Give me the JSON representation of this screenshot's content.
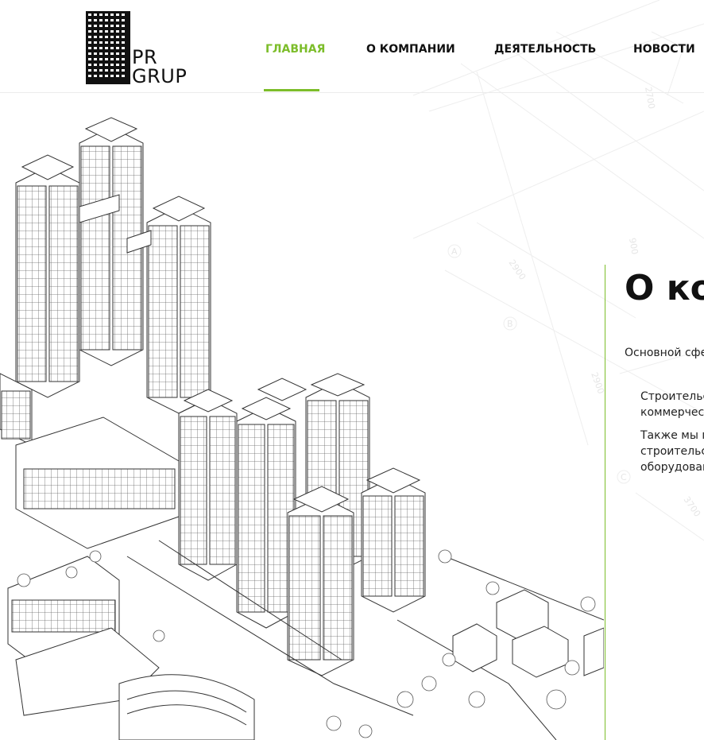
{
  "brand": {
    "line1": "PR",
    "line2": "GRUP"
  },
  "nav": {
    "items": [
      {
        "label": "ГЛАВНАЯ",
        "active": true
      },
      {
        "label": "О КОМПАНИИ",
        "active": false
      },
      {
        "label": "ДЕЯТЕЛЬНОСТЬ",
        "active": false
      },
      {
        "label": "НОВОСТИ",
        "active": false
      }
    ]
  },
  "about": {
    "title": "О ко",
    "lead": "Основной сфе",
    "paragraphs": [
      {
        "line1": "Строительст",
        "line2": "коммерческ"
      },
      {
        "line1": "Также мы го",
        "line2": "строительст",
        "line3": "оборудован"
      }
    ]
  },
  "drawing_marks": [
    "2700",
    "2900",
    "900",
    "A",
    "B",
    "C",
    "3700",
    "2900"
  ],
  "colors": {
    "accent": "#7cbd2a",
    "text": "#111111",
    "line": "#ececec"
  }
}
